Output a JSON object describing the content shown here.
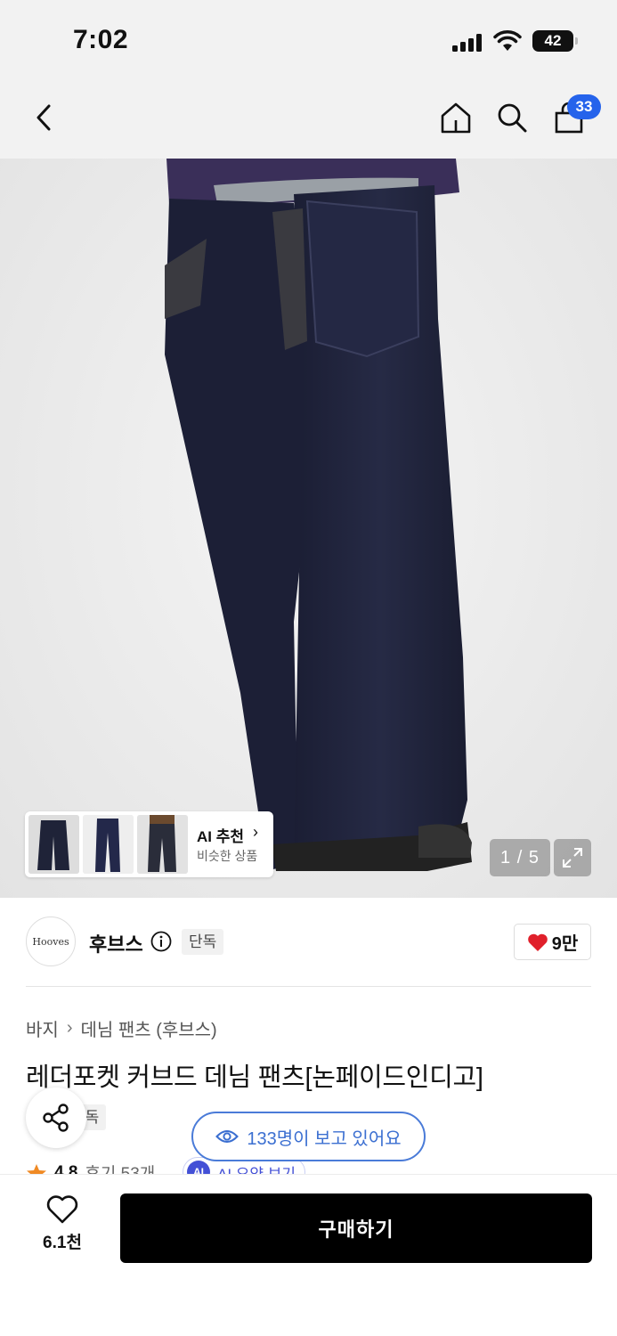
{
  "status_bar": {
    "time": "7:02",
    "battery": "42"
  },
  "nav": {
    "cart_count": "33",
    "icons": [
      "back-chevron-icon",
      "home-icon",
      "search-icon",
      "shopping-bag-icon"
    ]
  },
  "gallery": {
    "ai_recommend_title": "AI 추천",
    "ai_recommend_sub": "비슷한 상품",
    "counter": "1 / 5"
  },
  "brand": {
    "logo_text": "Hooves",
    "name": "후브스",
    "tag": "단독",
    "likes": "9만"
  },
  "product": {
    "breadcrumb": [
      "바지",
      "데님 팬츠 (후브스)"
    ],
    "title": "레더포켓 커브드 데님 팬츠[논페이드인디고]",
    "tag": "단독",
    "rating": "4.8",
    "reviews": "후기 53개",
    "ai_summary_badge": "AI",
    "ai_summary": "AI 요약 보기"
  },
  "overlay": {
    "viewers": "133명이 보고 있어요"
  },
  "bottom_bar": {
    "wish_count": "6.1천",
    "buy_label": "구매하기"
  },
  "colors": {
    "accent_blue": "#2563eb",
    "heart_red": "#e0202b",
    "buy_button": "#000000",
    "ai_purple": "#4350d6"
  }
}
